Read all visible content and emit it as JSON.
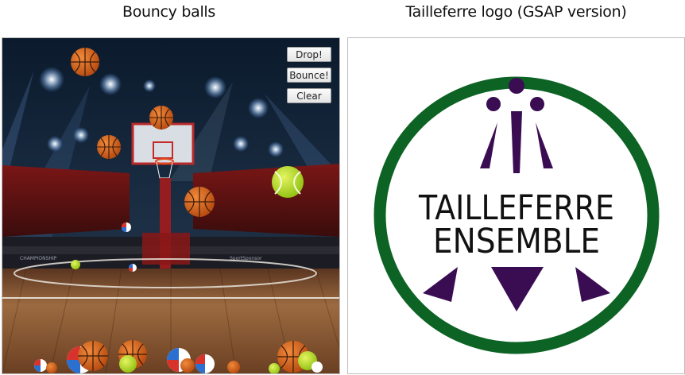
{
  "panels": {
    "left_title": "Bouncy balls",
    "right_title": "Tailleferre logo (GSAP version)"
  },
  "controls": {
    "drop_label": "Drop!",
    "bounce_label": "Bounce!",
    "clear_label": "Clear"
  },
  "arena": {
    "banner_left": "CHAMPIONSHIP",
    "banner_center": "SportSponsor"
  },
  "logo": {
    "line1": "TAILLEFERRE",
    "line2": "ENSEMBLE",
    "ring_color": "#0c6324",
    "shape_color": "#3a0d52"
  },
  "colors": {
    "basketball": "#d9651f",
    "tennis_ball": "#b9dd22",
    "beach_ball_red": "#d8322c",
    "beach_ball_blue": "#2b6fd1"
  }
}
